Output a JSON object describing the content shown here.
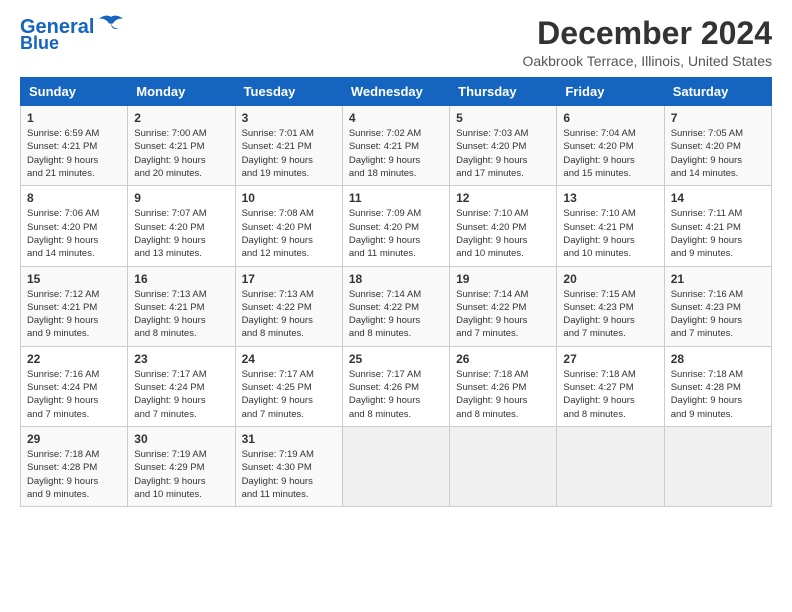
{
  "header": {
    "logo_line1": "General",
    "logo_line2": "Blue",
    "title": "December 2024",
    "subtitle": "Oakbrook Terrace, Illinois, United States"
  },
  "calendar": {
    "headers": [
      "Sunday",
      "Monday",
      "Tuesday",
      "Wednesday",
      "Thursday",
      "Friday",
      "Saturday"
    ],
    "weeks": [
      [
        {
          "day": "1",
          "info": "Sunrise: 6:59 AM\nSunset: 4:21 PM\nDaylight: 9 hours\nand 21 minutes."
        },
        {
          "day": "2",
          "info": "Sunrise: 7:00 AM\nSunset: 4:21 PM\nDaylight: 9 hours\nand 20 minutes."
        },
        {
          "day": "3",
          "info": "Sunrise: 7:01 AM\nSunset: 4:21 PM\nDaylight: 9 hours\nand 19 minutes."
        },
        {
          "day": "4",
          "info": "Sunrise: 7:02 AM\nSunset: 4:21 PM\nDaylight: 9 hours\nand 18 minutes."
        },
        {
          "day": "5",
          "info": "Sunrise: 7:03 AM\nSunset: 4:20 PM\nDaylight: 9 hours\nand 17 minutes."
        },
        {
          "day": "6",
          "info": "Sunrise: 7:04 AM\nSunset: 4:20 PM\nDaylight: 9 hours\nand 15 minutes."
        },
        {
          "day": "7",
          "info": "Sunrise: 7:05 AM\nSunset: 4:20 PM\nDaylight: 9 hours\nand 14 minutes."
        }
      ],
      [
        {
          "day": "8",
          "info": "Sunrise: 7:06 AM\nSunset: 4:20 PM\nDaylight: 9 hours\nand 14 minutes."
        },
        {
          "day": "9",
          "info": "Sunrise: 7:07 AM\nSunset: 4:20 PM\nDaylight: 9 hours\nand 13 minutes."
        },
        {
          "day": "10",
          "info": "Sunrise: 7:08 AM\nSunset: 4:20 PM\nDaylight: 9 hours\nand 12 minutes."
        },
        {
          "day": "11",
          "info": "Sunrise: 7:09 AM\nSunset: 4:20 PM\nDaylight: 9 hours\nand 11 minutes."
        },
        {
          "day": "12",
          "info": "Sunrise: 7:10 AM\nSunset: 4:20 PM\nDaylight: 9 hours\nand 10 minutes."
        },
        {
          "day": "13",
          "info": "Sunrise: 7:10 AM\nSunset: 4:21 PM\nDaylight: 9 hours\nand 10 minutes."
        },
        {
          "day": "14",
          "info": "Sunrise: 7:11 AM\nSunset: 4:21 PM\nDaylight: 9 hours\nand 9 minutes."
        }
      ],
      [
        {
          "day": "15",
          "info": "Sunrise: 7:12 AM\nSunset: 4:21 PM\nDaylight: 9 hours\nand 9 minutes."
        },
        {
          "day": "16",
          "info": "Sunrise: 7:13 AM\nSunset: 4:21 PM\nDaylight: 9 hours\nand 8 minutes."
        },
        {
          "day": "17",
          "info": "Sunrise: 7:13 AM\nSunset: 4:22 PM\nDaylight: 9 hours\nand 8 minutes."
        },
        {
          "day": "18",
          "info": "Sunrise: 7:14 AM\nSunset: 4:22 PM\nDaylight: 9 hours\nand 8 minutes."
        },
        {
          "day": "19",
          "info": "Sunrise: 7:14 AM\nSunset: 4:22 PM\nDaylight: 9 hours\nand 7 minutes."
        },
        {
          "day": "20",
          "info": "Sunrise: 7:15 AM\nSunset: 4:23 PM\nDaylight: 9 hours\nand 7 minutes."
        },
        {
          "day": "21",
          "info": "Sunrise: 7:16 AM\nSunset: 4:23 PM\nDaylight: 9 hours\nand 7 minutes."
        }
      ],
      [
        {
          "day": "22",
          "info": "Sunrise: 7:16 AM\nSunset: 4:24 PM\nDaylight: 9 hours\nand 7 minutes."
        },
        {
          "day": "23",
          "info": "Sunrise: 7:17 AM\nSunset: 4:24 PM\nDaylight: 9 hours\nand 7 minutes."
        },
        {
          "day": "24",
          "info": "Sunrise: 7:17 AM\nSunset: 4:25 PM\nDaylight: 9 hours\nand 7 minutes."
        },
        {
          "day": "25",
          "info": "Sunrise: 7:17 AM\nSunset: 4:26 PM\nDaylight: 9 hours\nand 8 minutes."
        },
        {
          "day": "26",
          "info": "Sunrise: 7:18 AM\nSunset: 4:26 PM\nDaylight: 9 hours\nand 8 minutes."
        },
        {
          "day": "27",
          "info": "Sunrise: 7:18 AM\nSunset: 4:27 PM\nDaylight: 9 hours\nand 8 minutes."
        },
        {
          "day": "28",
          "info": "Sunrise: 7:18 AM\nSunset: 4:28 PM\nDaylight: 9 hours\nand 9 minutes."
        }
      ],
      [
        {
          "day": "29",
          "info": "Sunrise: 7:18 AM\nSunset: 4:28 PM\nDaylight: 9 hours\nand 9 minutes."
        },
        {
          "day": "30",
          "info": "Sunrise: 7:19 AM\nSunset: 4:29 PM\nDaylight: 9 hours\nand 10 minutes."
        },
        {
          "day": "31",
          "info": "Sunrise: 7:19 AM\nSunset: 4:30 PM\nDaylight: 9 hours\nand 11 minutes."
        },
        null,
        null,
        null,
        null
      ]
    ]
  }
}
